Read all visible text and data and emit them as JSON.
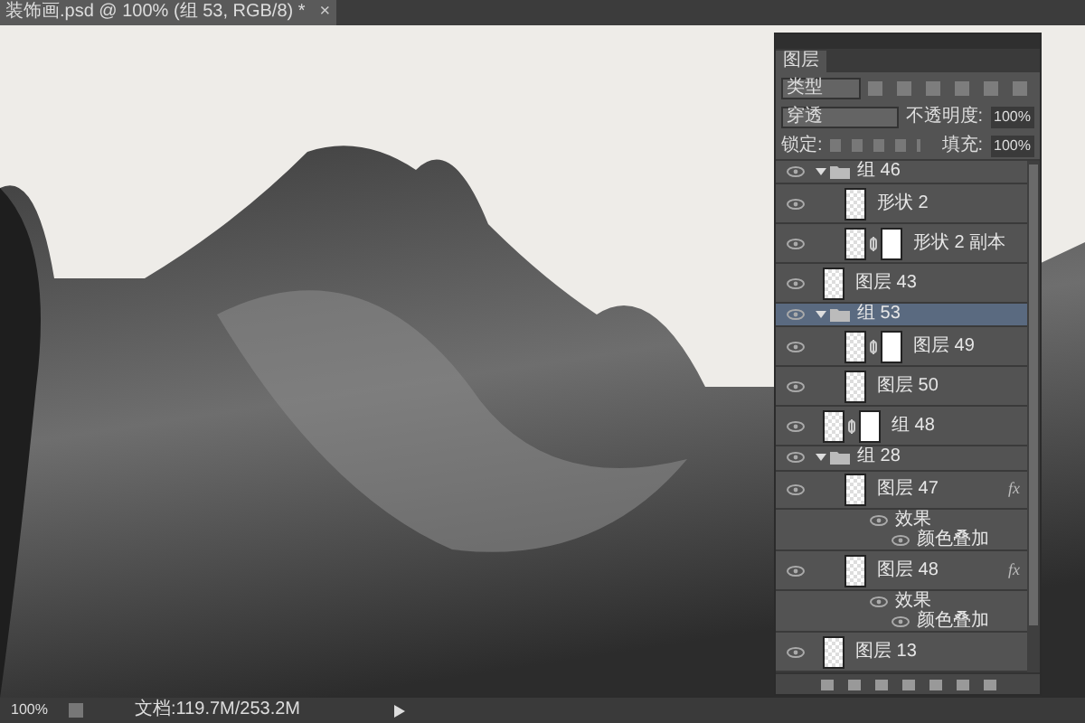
{
  "document_tab": {
    "title": "装饰画.psd @ 100% (组 53, RGB/8) *",
    "close": "×"
  },
  "layers_panel": {
    "tab": "图层",
    "filter": {
      "value": "类型"
    },
    "blend_mode": {
      "value": "穿透"
    },
    "opacity": {
      "label": "不透明度:",
      "value": "100%"
    },
    "lock": {
      "label": "锁定:"
    },
    "fill": {
      "label": "填充:",
      "value": "100%"
    },
    "layers": [
      {
        "kind": "group",
        "name": "组 46",
        "selected": false,
        "expanded": true,
        "children": [
          {
            "kind": "layer",
            "name": "形状 2",
            "selected": false,
            "mask": false
          },
          {
            "kind": "layer",
            "name": "形状 2 副本",
            "selected": false,
            "mask": true
          }
        ]
      },
      {
        "kind": "layer",
        "name": "图层 43",
        "selected": false,
        "mask": false
      },
      {
        "kind": "group",
        "name": "组 53",
        "selected": true,
        "expanded": true,
        "children": [
          {
            "kind": "layer",
            "name": "图层 49",
            "selected": false,
            "mask": true
          },
          {
            "kind": "layer",
            "name": "图层 50",
            "selected": false,
            "mask": false
          }
        ]
      },
      {
        "kind": "layer",
        "name": "组 48",
        "selected": false,
        "mask": true
      },
      {
        "kind": "group",
        "name": "组 28",
        "selected": false,
        "expanded": true,
        "children": [
          {
            "kind": "layer",
            "name": "图层 47",
            "selected": false,
            "mask": false,
            "fx": "fx",
            "effects_label": "效果",
            "effects": [
              "颜色叠加"
            ]
          },
          {
            "kind": "layer",
            "name": "图层 48",
            "selected": false,
            "mask": false,
            "fx": "fx",
            "effects_label": "效果",
            "effects": [
              "颜色叠加"
            ]
          }
        ]
      },
      {
        "kind": "layer",
        "name": "图层 13",
        "selected": false,
        "mask": false
      }
    ]
  },
  "status_bar": {
    "zoom": "100%",
    "doc_info": "文档:119.7M/253.2M"
  }
}
